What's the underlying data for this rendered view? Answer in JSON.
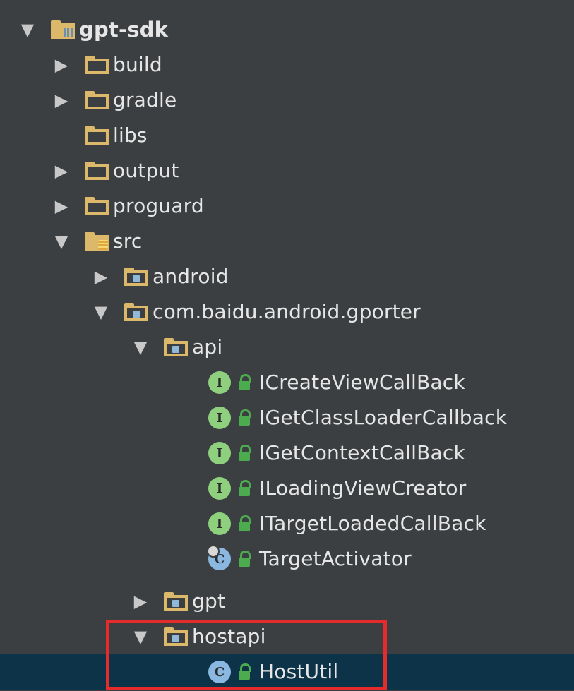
{
  "tree": {
    "root": {
      "label": "gpt-sdk",
      "expanded": true
    },
    "items": [
      {
        "label": "build",
        "expanded": false
      },
      {
        "label": "gradle",
        "expanded": false
      },
      {
        "label": "libs"
      },
      {
        "label": "output",
        "expanded": false
      },
      {
        "label": "proguard",
        "expanded": false
      },
      {
        "label": "src",
        "expanded": true
      },
      {
        "label": "android",
        "expanded": false
      },
      {
        "label": "com.baidu.android.gporter",
        "expanded": true
      },
      {
        "label": "api",
        "expanded": true
      },
      {
        "label": "ICreateViewCallBack",
        "kind": "interface",
        "badge": "I"
      },
      {
        "label": "IGetClassLoaderCallback",
        "kind": "interface",
        "badge": "I"
      },
      {
        "label": "IGetContextCallBack",
        "kind": "interface",
        "badge": "I"
      },
      {
        "label": "ILoadingViewCreator",
        "kind": "interface",
        "badge": "I"
      },
      {
        "label": "ITargetLoadedCallBack",
        "kind": "interface",
        "badge": "I"
      },
      {
        "label": "TargetActivator",
        "kind": "class",
        "badge": "C"
      },
      {
        "label": "gpt",
        "expanded": false
      },
      {
        "label": "hostapi",
        "expanded": true
      },
      {
        "label": "HostUtil",
        "kind": "class",
        "badge": "C",
        "selected": true
      }
    ]
  },
  "arrows": {
    "expanded": "▼",
    "collapsed": "▶"
  },
  "colors": {
    "background": "#3c3f41",
    "selection": "#0d3349",
    "folder": "#dcb86a",
    "interface": "#8fd07f",
    "class": "#8ab8e0",
    "highlight": "#e52b2b"
  }
}
